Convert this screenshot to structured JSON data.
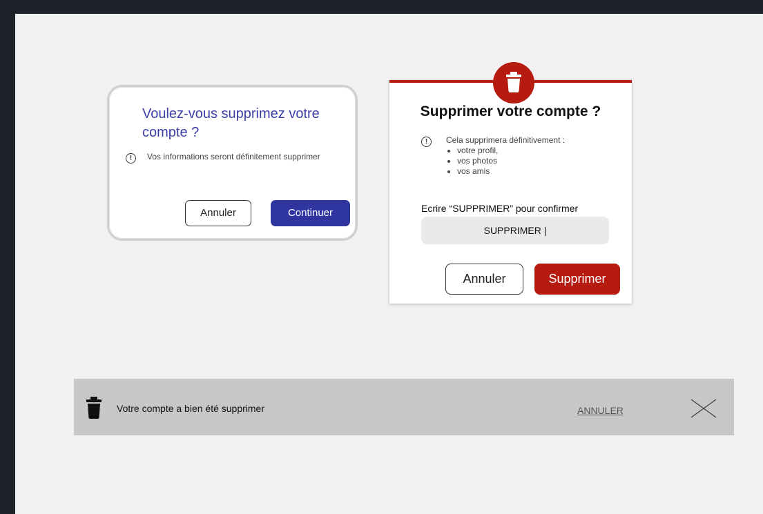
{
  "dialog_simple": {
    "title": "Voulez-vous supprimez votre compte ?",
    "info": "Vos informations seront définitement supprimer",
    "cancel_label": "Annuler",
    "continue_label": "Continuer",
    "accent_color": "#3036a0"
  },
  "dialog_confirm": {
    "title": "Supprimer votre compte ?",
    "warning_intro": "Cela supprimera définitivement :",
    "warning_items": [
      "votre profil,",
      "vos photos",
      "vos amis"
    ],
    "confirm_label": "Ecrire “SUPPRIMER” pour confirmer",
    "input_value": "SUPPRIMER |",
    "cancel_label": "Annuler",
    "delete_label": "Supprimer",
    "accent_color": "#b51b0e",
    "badge_icon": "trash-icon"
  },
  "snackbar": {
    "message": "Votre compte a bien été supprimer",
    "undo_label": "ANNULER",
    "icon": "trash-icon",
    "close_icon": "close-icon"
  }
}
